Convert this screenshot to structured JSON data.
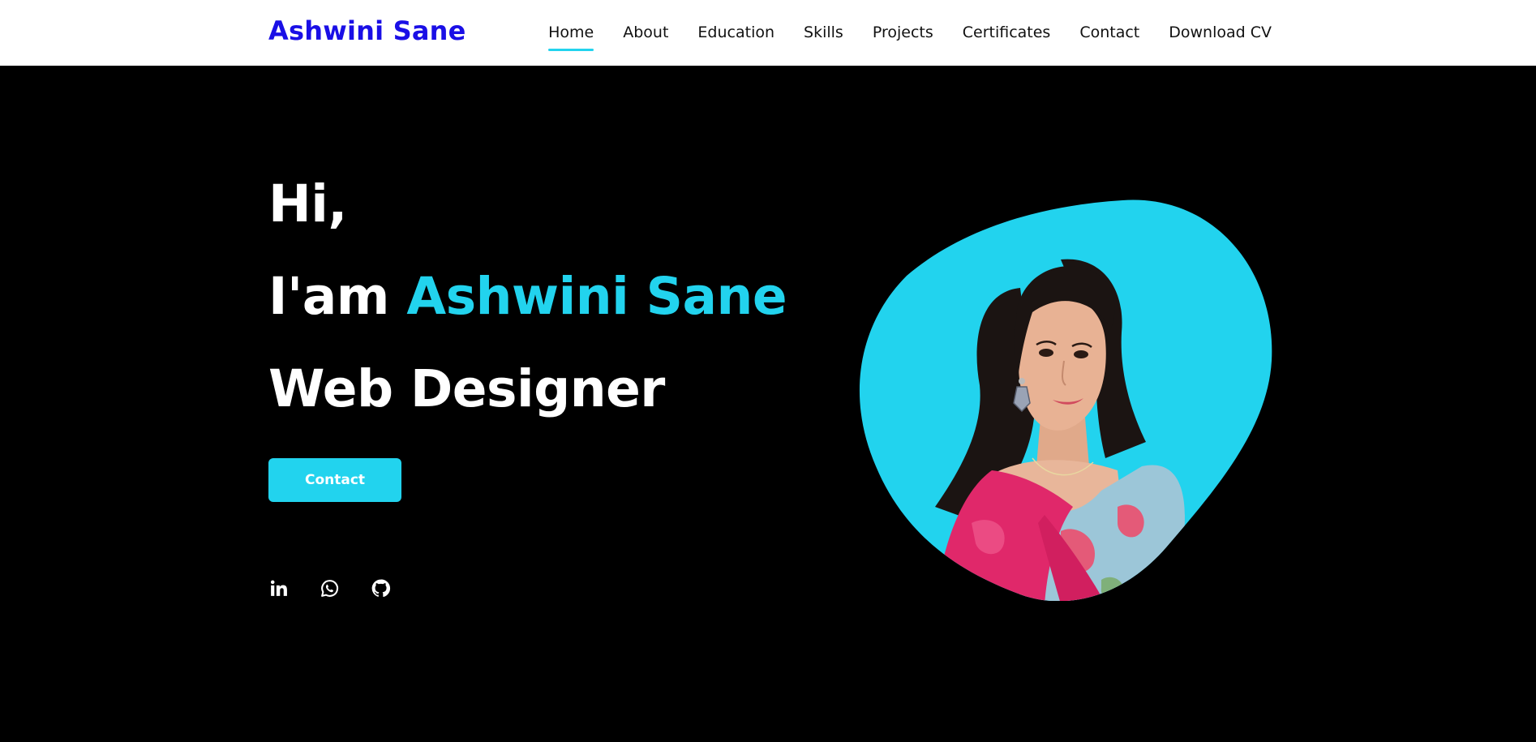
{
  "header": {
    "brand": "Ashwini Sane",
    "nav": [
      {
        "label": "Home",
        "active": true
      },
      {
        "label": "About"
      },
      {
        "label": "Education"
      },
      {
        "label": "Skills"
      },
      {
        "label": "Projects"
      },
      {
        "label": "Certificates"
      },
      {
        "label": "Contact"
      },
      {
        "label": "Download CV"
      }
    ]
  },
  "hero": {
    "greeting": "Hi,",
    "intro_prefix": "I'am",
    "name": "Ashwini Sane",
    "role": "Web Designer",
    "contact_button": "Contact",
    "socials": [
      {
        "icon": "linkedin-icon"
      },
      {
        "icon": "whatsapp-icon"
      },
      {
        "icon": "github-icon"
      }
    ]
  },
  "colors": {
    "brand": "#1a0fe6",
    "accent": "#22d3ee",
    "background": "#000000",
    "nav_background": "#ffffff"
  }
}
